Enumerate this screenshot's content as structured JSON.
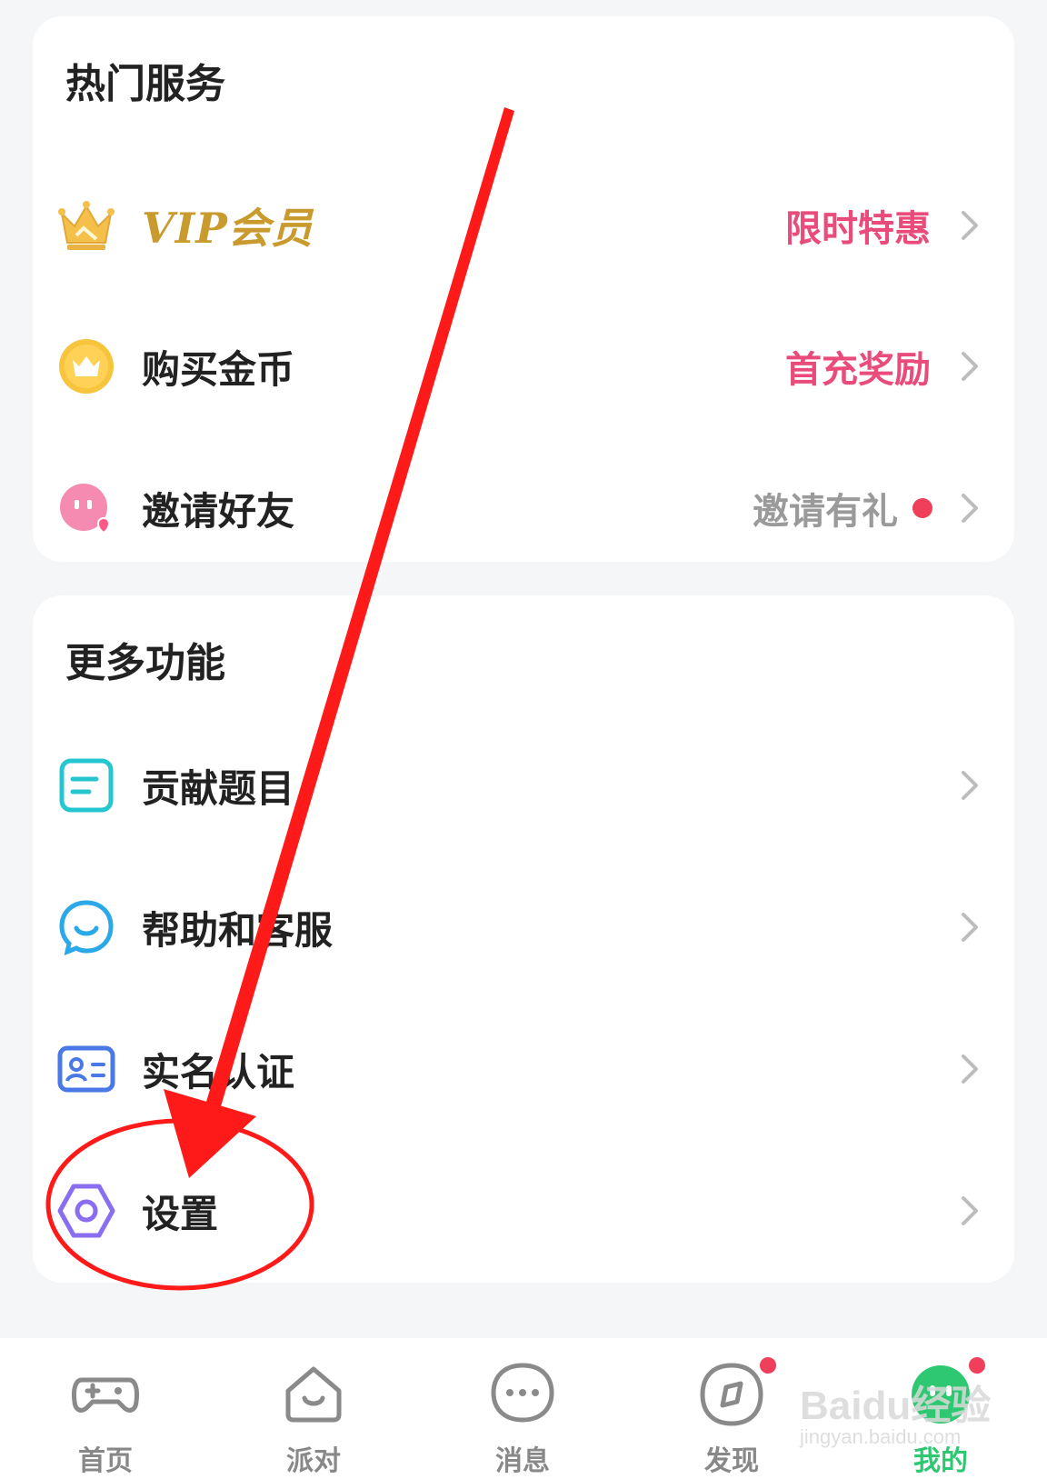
{
  "hot_services": {
    "title": "热门服务",
    "items": [
      {
        "label": "VIP会员",
        "right_text": "限时特惠",
        "icon": "crown-icon"
      },
      {
        "label": "购买金币",
        "right_text": "首充奖励",
        "icon": "coin-crown-icon"
      },
      {
        "label": "邀请好友",
        "right_text": "邀请有礼",
        "icon": "invite-face-icon",
        "has_dot": true
      }
    ]
  },
  "more_features": {
    "title": "更多功能",
    "items": [
      {
        "label": "贡献题目",
        "icon": "document-icon"
      },
      {
        "label": "帮助和客服",
        "icon": "chat-smile-icon"
      },
      {
        "label": "实名认证",
        "icon": "id-card-icon"
      },
      {
        "label": "设置",
        "icon": "hexagon-gear-icon"
      }
    ]
  },
  "tabbar": {
    "tabs": [
      {
        "label": "首页",
        "icon": "gamepad-icon"
      },
      {
        "label": "派对",
        "icon": "party-house-icon"
      },
      {
        "label": "消息",
        "icon": "message-dots-icon"
      },
      {
        "label": "发现",
        "icon": "compass-icon",
        "badge": true
      },
      {
        "label": "我的",
        "icon": "profile-face-icon",
        "badge": true,
        "active": true
      }
    ]
  },
  "watermark": {
    "line1": "Baidu经验",
    "line2": "jingyan.baidu.com"
  },
  "colors": {
    "accent_pink": "#e94c7a",
    "vip_gold": "#c99a2e",
    "active_green": "#2ec873",
    "badge_red": "#ef3f5a",
    "annotation_red": "#ff1a1a"
  }
}
